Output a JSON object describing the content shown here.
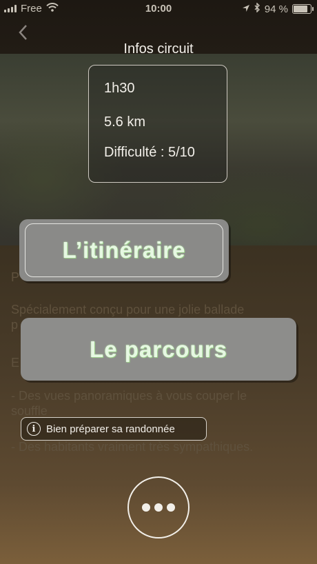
{
  "status_bar": {
    "carrier": "Free",
    "time": "10:00",
    "battery_text": "94 %",
    "battery_level": 0.94,
    "icons": [
      "signal-icon",
      "wifi-icon",
      "location-arrow-icon",
      "bluetooth-icon",
      "battery-icon"
    ]
  },
  "nav": {
    "back_icon": "chevron-left-icon",
    "title": "Infos circuit"
  },
  "info": {
    "duration": "1h30",
    "distance": "5.6 km",
    "difficulty": "Difficulté : 5/10"
  },
  "description": {
    "line_p": "P",
    "intro": "Spécialement conçu pour une jolie ballade",
    "intro_cont": "p",
    "line_e": "E",
    "bullet1": "- Des vues panoramiques à vous couper le",
    "bullet1_cont": "souffle",
    "bullet2": "- Des habitants vraiment très sympathiques."
  },
  "buttons": {
    "itineraire": "L’itinéraire",
    "parcours": "Le parcours",
    "prepare": "Bien préparer sa randonnée",
    "prepare_icon": "info-circle-icon",
    "more_icon": "more-dots-icon"
  }
}
